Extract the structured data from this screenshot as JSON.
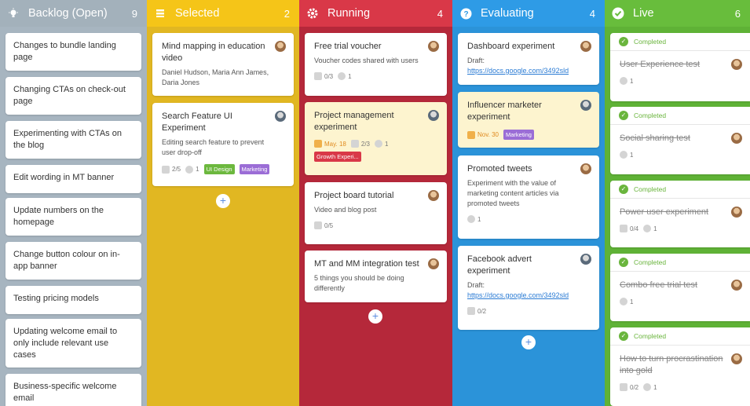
{
  "columns": [
    {
      "key": "backlog",
      "title": "Backlog (Open)",
      "count": "9",
      "icon": "bulb-icon",
      "color": "#a7b5c0",
      "head_color": "#a3b1bb",
      "cards": [
        {
          "title": "Changes to bundle landing page"
        },
        {
          "title": "Changing CTAs on check-out page"
        },
        {
          "title": "Experimenting with CTAs on the blog"
        },
        {
          "title": "Edit wording in MT banner"
        },
        {
          "title": "Update numbers on the homepage"
        },
        {
          "title": "Change button colour on in-app banner"
        },
        {
          "title": "Testing pricing models"
        },
        {
          "title": "Updating welcome email to only include relevant use cases"
        },
        {
          "title": "Business-specific welcome email"
        }
      ]
    },
    {
      "key": "selected",
      "title": "Selected",
      "count": "2",
      "icon": "stack-icon",
      "color": "#e1b722",
      "head_color": "#f5c518",
      "cards": [
        {
          "title": "Mind mapping in education video",
          "desc": "Daniel Hudson, Maria Ann James, Daria Jones",
          "avatar": "f"
        },
        {
          "title": "Search Feature UI Experiment",
          "desc": "Editing search feature to prevent user drop-off",
          "avatar": "m",
          "checklist": "2/5",
          "comments": "1",
          "tags": [
            {
              "label": "UI Design",
              "color": "#6cb83e"
            },
            {
              "label": "Marketing",
              "color": "#9b6dd6"
            }
          ]
        }
      ]
    },
    {
      "key": "running",
      "title": "Running",
      "count": "4",
      "icon": "gear-icon",
      "color": "#b5283a",
      "head_color": "#d93848",
      "cards": [
        {
          "title": "Free trial voucher",
          "desc": "Voucher codes shared with users",
          "avatar": "f",
          "checklist": "0/3",
          "comments": "1"
        },
        {
          "title": "Project management experiment",
          "avatar": "m",
          "yellow": true,
          "date": "May. 18",
          "checklist": "2/3",
          "comments": "1",
          "tags": [
            {
              "label": "Growth Experi...",
              "color": "#d93848"
            }
          ]
        },
        {
          "title": "Project board tutorial",
          "desc": "Video and blog post",
          "avatar": "f",
          "checklist": "0/5"
        },
        {
          "title": "MT and MM integration test",
          "desc": "5 things you should be doing differently",
          "avatar": "f"
        }
      ]
    },
    {
      "key": "evaluating",
      "title": "Evaluating",
      "count": "4",
      "icon": "question-icon",
      "color": "#2b93d9",
      "head_color": "#2e9be6",
      "cards": [
        {
          "title": "Dashboard experiment",
          "desc": "Draft:",
          "link": "https://docs.google.com/3492sld",
          "avatar": "f"
        },
        {
          "title": "Influencer marketer experiment",
          "avatar": "m",
          "yellow": true,
          "date": "Nov. 30",
          "tags": [
            {
              "label": "Marketing",
              "color": "#9b6dd6"
            }
          ]
        },
        {
          "title": "Promoted tweets",
          "desc": "Experiment with the value of marketing content articles via promoted tweets",
          "avatar": "f",
          "comments": "1"
        },
        {
          "title": "Facebook advert experiment",
          "desc": "Draft:",
          "link": "https://docs.google.com/3492sld",
          "avatar": "m",
          "checklist": "0/2"
        }
      ]
    },
    {
      "key": "live",
      "title": "Live",
      "count": "6",
      "icon": "check-circle-icon",
      "color": "#5fb236",
      "head_color": "#68bd3c",
      "cards": [
        {
          "status": "Completed",
          "title": "User Experience test",
          "attach": "1"
        },
        {
          "status": "Completed",
          "title": "Social sharing test",
          "attach": "1"
        },
        {
          "status": "Completed",
          "title": "Power user experiment",
          "checklist": "0/4",
          "attach": "1"
        },
        {
          "status": "Completed",
          "title": "Combo free trial test",
          "attach": "1"
        },
        {
          "status": "Completed",
          "title": "How to turn procrastination into gold",
          "checklist": "0/2",
          "attach": "1"
        }
      ]
    }
  ]
}
